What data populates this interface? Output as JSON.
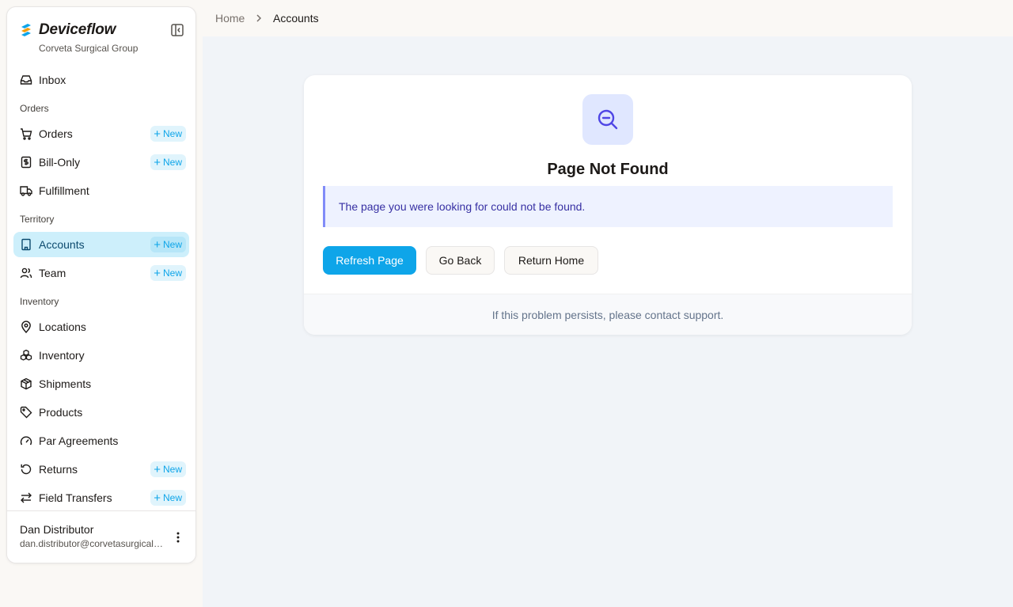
{
  "brand": {
    "name": "Deviceflow",
    "org": "Corveta Surgical Group"
  },
  "sidebar": {
    "sections": {
      "orders": "Orders",
      "territory": "Territory",
      "inventory": "Inventory"
    },
    "items": [
      {
        "label": "Inbox",
        "icon": "inbox-icon"
      },
      {
        "label": "Orders",
        "icon": "cart-icon",
        "badge": "New"
      },
      {
        "label": "Bill-Only",
        "icon": "receipt-dollar-icon",
        "badge": "New"
      },
      {
        "label": "Fulfillment",
        "icon": "truck-icon"
      },
      {
        "label": "Accounts",
        "icon": "building-icon",
        "badge": "New",
        "active": true
      },
      {
        "label": "Team",
        "icon": "users-icon",
        "badge": "New"
      },
      {
        "label": "Locations",
        "icon": "map-pin-icon"
      },
      {
        "label": "Inventory",
        "icon": "boxes-icon"
      },
      {
        "label": "Shipments",
        "icon": "package-icon"
      },
      {
        "label": "Products",
        "icon": "tag-icon"
      },
      {
        "label": "Par Agreements",
        "icon": "gauge-icon"
      },
      {
        "label": "Returns",
        "icon": "rotate-ccw-icon",
        "badge": "New"
      },
      {
        "label": "Field Transfers",
        "icon": "arrows-left-right-icon",
        "badge": "New"
      }
    ],
    "user": {
      "name": "Dan Distributor",
      "email": "dan.distributor@corvetasurgicalgroup.com"
    }
  },
  "breadcrumb": {
    "home": "Home",
    "current": "Accounts"
  },
  "error": {
    "title": "Page Not Found",
    "message": "The page you were looking for could not be found.",
    "buttons": {
      "refresh": "Refresh Page",
      "back": "Go Back",
      "home": "Return Home"
    },
    "footer": "If this problem persists, please contact support."
  },
  "colors": {
    "accent": "#0ea5e9",
    "active_bg": "#cdeffb",
    "alert_bg": "#eef2ff",
    "alert_border": "#818cf8",
    "alert_text": "#3730a3",
    "icon_indigo": "#4f46e5"
  }
}
